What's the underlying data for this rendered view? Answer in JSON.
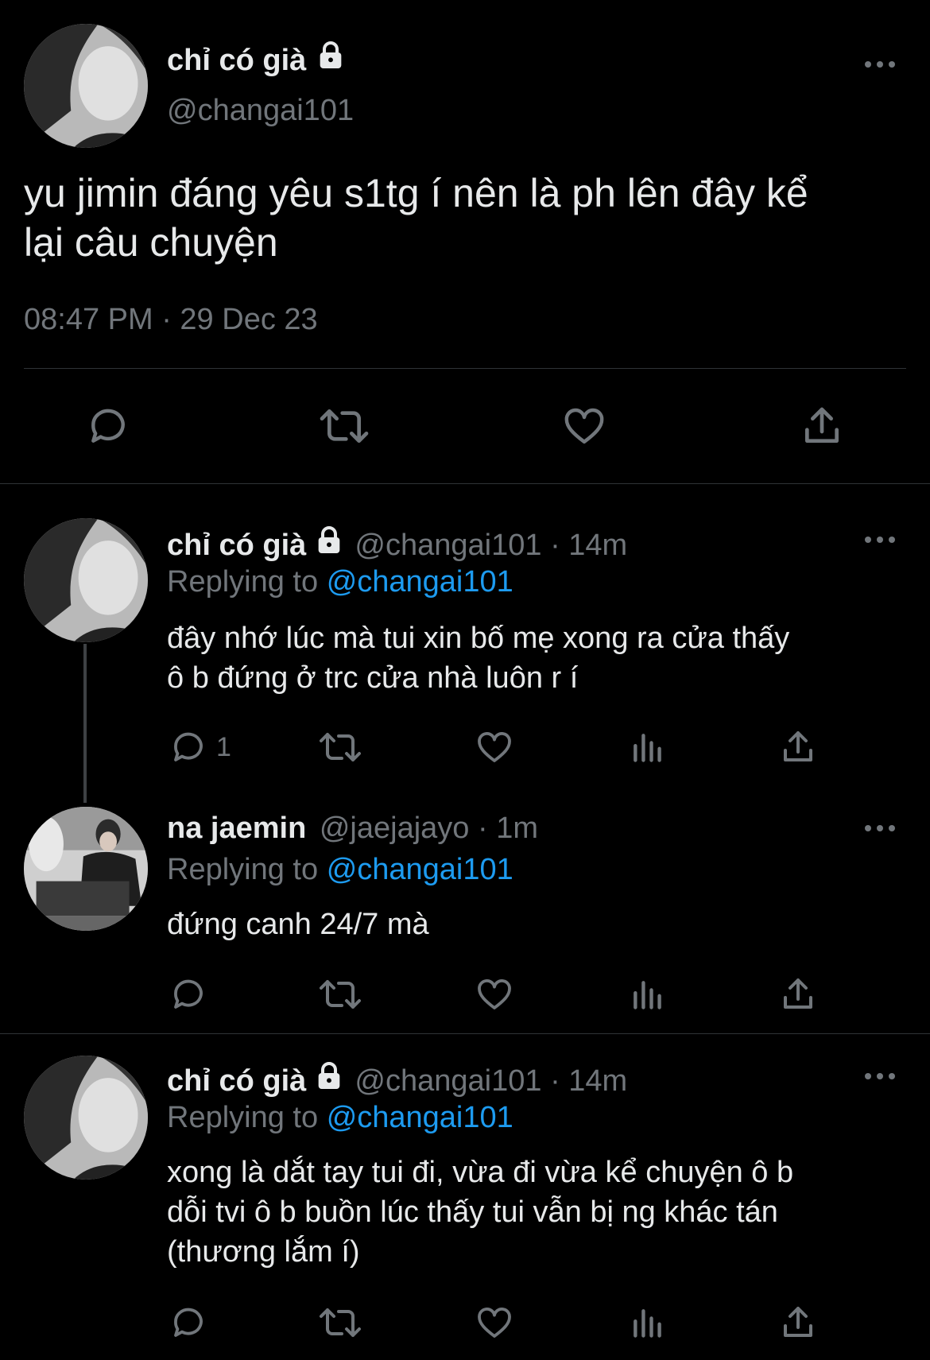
{
  "main_tweet": {
    "display_name": "chỉ có già",
    "handle": "@changai101",
    "text_line1": "yu jimin đáng yêu s1tg í nên là ph lên đây kể",
    "text_line2": "lại câu chuyện",
    "timestamp": "08:47 PM · 29 Dec 23"
  },
  "replies": [
    {
      "display_name": "chỉ có già",
      "handle": "@changai101",
      "time": "· 14m",
      "replying_label": "Replying to",
      "replying_to": "@changai101",
      "text_lines": [
        "đây nhớ lúc mà tui xin bố mẹ xong ra cửa thấy",
        "ô b đứng ở trc cửa nhà luôn r í"
      ],
      "reply_count": "1"
    },
    {
      "display_name": "na jaemin",
      "handle": "@jaejajayo",
      "time": "· 1m",
      "replying_label": "Replying to",
      "replying_to": "@changai101",
      "text_lines": [
        "đứng canh 24/7 mà"
      ],
      "reply_count": ""
    },
    {
      "display_name": "chỉ có già",
      "handle": "@changai101",
      "time": "· 14m",
      "replying_label": "Replying to",
      "replying_to": "@changai101",
      "text_lines": [
        "xong là dắt tay tui đi, vừa đi vừa kể chuyện ô b",
        "dỗi tvi ô b buồn lúc thấy tui vẫn bị ng khác tán",
        "(thương lắm í)"
      ],
      "reply_count": ""
    }
  ],
  "icons": [
    "reply-icon",
    "retweet-icon",
    "like-icon",
    "share-icon",
    "views-icon",
    "lock-icon",
    "more-icon"
  ],
  "colors": {
    "background": "#000000",
    "text": "#e7e9ea",
    "muted": "#71767b",
    "link": "#1d9bf0",
    "divider": "#2f3336"
  }
}
